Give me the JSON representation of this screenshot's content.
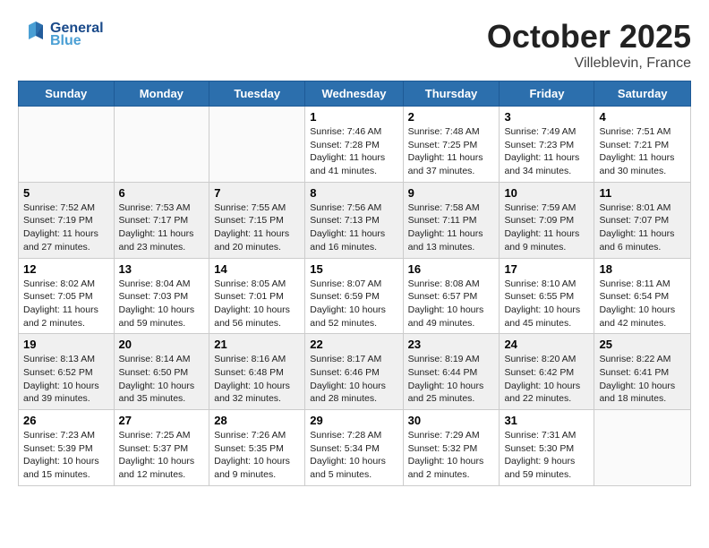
{
  "header": {
    "logo_line1": "General",
    "logo_line2": "Blue",
    "month": "October 2025",
    "location": "Villeblevin, France"
  },
  "weekdays": [
    "Sunday",
    "Monday",
    "Tuesday",
    "Wednesday",
    "Thursday",
    "Friday",
    "Saturday"
  ],
  "weeks": [
    [
      {
        "day": "",
        "info": ""
      },
      {
        "day": "",
        "info": ""
      },
      {
        "day": "",
        "info": ""
      },
      {
        "day": "1",
        "info": "Sunrise: 7:46 AM\nSunset: 7:28 PM\nDaylight: 11 hours\nand 41 minutes."
      },
      {
        "day": "2",
        "info": "Sunrise: 7:48 AM\nSunset: 7:25 PM\nDaylight: 11 hours\nand 37 minutes."
      },
      {
        "day": "3",
        "info": "Sunrise: 7:49 AM\nSunset: 7:23 PM\nDaylight: 11 hours\nand 34 minutes."
      },
      {
        "day": "4",
        "info": "Sunrise: 7:51 AM\nSunset: 7:21 PM\nDaylight: 11 hours\nand 30 minutes."
      }
    ],
    [
      {
        "day": "5",
        "info": "Sunrise: 7:52 AM\nSunset: 7:19 PM\nDaylight: 11 hours\nand 27 minutes."
      },
      {
        "day": "6",
        "info": "Sunrise: 7:53 AM\nSunset: 7:17 PM\nDaylight: 11 hours\nand 23 minutes."
      },
      {
        "day": "7",
        "info": "Sunrise: 7:55 AM\nSunset: 7:15 PM\nDaylight: 11 hours\nand 20 minutes."
      },
      {
        "day": "8",
        "info": "Sunrise: 7:56 AM\nSunset: 7:13 PM\nDaylight: 11 hours\nand 16 minutes."
      },
      {
        "day": "9",
        "info": "Sunrise: 7:58 AM\nSunset: 7:11 PM\nDaylight: 11 hours\nand 13 minutes."
      },
      {
        "day": "10",
        "info": "Sunrise: 7:59 AM\nSunset: 7:09 PM\nDaylight: 11 hours\nand 9 minutes."
      },
      {
        "day": "11",
        "info": "Sunrise: 8:01 AM\nSunset: 7:07 PM\nDaylight: 11 hours\nand 6 minutes."
      }
    ],
    [
      {
        "day": "12",
        "info": "Sunrise: 8:02 AM\nSunset: 7:05 PM\nDaylight: 11 hours\nand 2 minutes."
      },
      {
        "day": "13",
        "info": "Sunrise: 8:04 AM\nSunset: 7:03 PM\nDaylight: 10 hours\nand 59 minutes."
      },
      {
        "day": "14",
        "info": "Sunrise: 8:05 AM\nSunset: 7:01 PM\nDaylight: 10 hours\nand 56 minutes."
      },
      {
        "day": "15",
        "info": "Sunrise: 8:07 AM\nSunset: 6:59 PM\nDaylight: 10 hours\nand 52 minutes."
      },
      {
        "day": "16",
        "info": "Sunrise: 8:08 AM\nSunset: 6:57 PM\nDaylight: 10 hours\nand 49 minutes."
      },
      {
        "day": "17",
        "info": "Sunrise: 8:10 AM\nSunset: 6:55 PM\nDaylight: 10 hours\nand 45 minutes."
      },
      {
        "day": "18",
        "info": "Sunrise: 8:11 AM\nSunset: 6:54 PM\nDaylight: 10 hours\nand 42 minutes."
      }
    ],
    [
      {
        "day": "19",
        "info": "Sunrise: 8:13 AM\nSunset: 6:52 PM\nDaylight: 10 hours\nand 39 minutes."
      },
      {
        "day": "20",
        "info": "Sunrise: 8:14 AM\nSunset: 6:50 PM\nDaylight: 10 hours\nand 35 minutes."
      },
      {
        "day": "21",
        "info": "Sunrise: 8:16 AM\nSunset: 6:48 PM\nDaylight: 10 hours\nand 32 minutes."
      },
      {
        "day": "22",
        "info": "Sunrise: 8:17 AM\nSunset: 6:46 PM\nDaylight: 10 hours\nand 28 minutes."
      },
      {
        "day": "23",
        "info": "Sunrise: 8:19 AM\nSunset: 6:44 PM\nDaylight: 10 hours\nand 25 minutes."
      },
      {
        "day": "24",
        "info": "Sunrise: 8:20 AM\nSunset: 6:42 PM\nDaylight: 10 hours\nand 22 minutes."
      },
      {
        "day": "25",
        "info": "Sunrise: 8:22 AM\nSunset: 6:41 PM\nDaylight: 10 hours\nand 18 minutes."
      }
    ],
    [
      {
        "day": "26",
        "info": "Sunrise: 7:23 AM\nSunset: 5:39 PM\nDaylight: 10 hours\nand 15 minutes."
      },
      {
        "day": "27",
        "info": "Sunrise: 7:25 AM\nSunset: 5:37 PM\nDaylight: 10 hours\nand 12 minutes."
      },
      {
        "day": "28",
        "info": "Sunrise: 7:26 AM\nSunset: 5:35 PM\nDaylight: 10 hours\nand 9 minutes."
      },
      {
        "day": "29",
        "info": "Sunrise: 7:28 AM\nSunset: 5:34 PM\nDaylight: 10 hours\nand 5 minutes."
      },
      {
        "day": "30",
        "info": "Sunrise: 7:29 AM\nSunset: 5:32 PM\nDaylight: 10 hours\nand 2 minutes."
      },
      {
        "day": "31",
        "info": "Sunrise: 7:31 AM\nSunset: 5:30 PM\nDaylight: 9 hours\nand 59 minutes."
      },
      {
        "day": "",
        "info": ""
      }
    ]
  ]
}
